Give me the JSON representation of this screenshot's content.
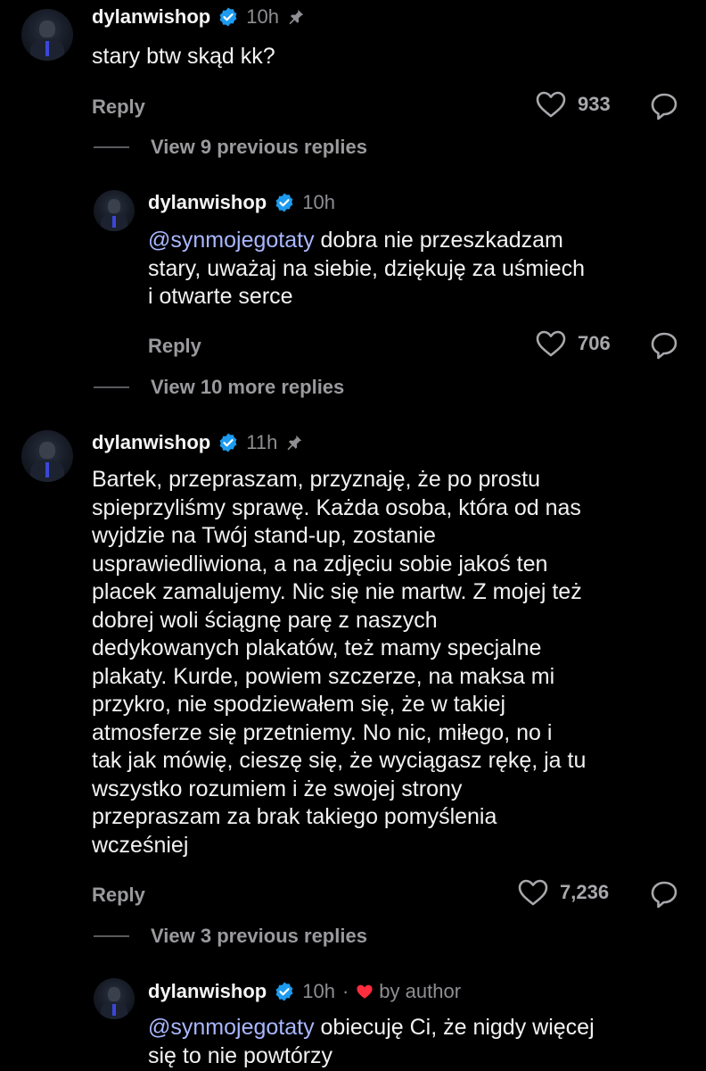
{
  "comments": [
    {
      "username": "dylanwishop",
      "time": "10h",
      "pinned": true,
      "text": "stary btw skąd kk?",
      "reply_label": "Reply",
      "likes": "933"
    },
    {
      "username": "dylanwishop",
      "time": "10h",
      "mention": "@synmojegotaty",
      "text_line1": " dobra nie przeszkadzam",
      "text_line2": "stary, uważaj na siebie, dziękuję za uśmiech",
      "text_line3": "i otwarte serce",
      "reply_label": "Reply",
      "likes": "706"
    },
    {
      "username": "dylanwishop",
      "time": "11h",
      "pinned": true,
      "lines": [
        "Bartek, przepraszam, przyznaję, że po prostu",
        "spieprzyliśmy sprawę. Każda osoba, która od nas",
        "wyjdzie na Twój stand-up, zostanie",
        "usprawiedliwiona, a na zdjęciu sobie jakoś ten",
        "placek zamalujemy. Nic się nie martw. Z mojej też",
        "dobrej woli ściągnę parę z naszych",
        "dedykowanych plakatów, też mamy specjalne",
        "plakaty. Kurde, powiem szczerze, na maksa mi",
        "przykro, nie spodziewałem się, że w takiej",
        "atmosferze się przetniemy. No nic, miłego, no i",
        "tak jak mówię, cieszę się, że wyciągasz rękę, ja tu",
        "wszystko rozumiem i że swojej strony",
        "przepraszam za brak takiego pomyślenia",
        "wcześniej"
      ],
      "reply_label": "Reply",
      "likes": "7,236"
    },
    {
      "username": "dylanwishop",
      "time": "10h",
      "separator": "·",
      "by_author": "by author",
      "mention": "@synmojegotaty",
      "text_line1": " obiecuję Ci, że nigdy więcej",
      "text_line2": "się to nie powtórzy"
    }
  ],
  "view_links": {
    "first": "View 9 previous replies",
    "second": "View 10 more replies",
    "third": "View 3 previous replies"
  },
  "colors": {
    "background": "#000000",
    "mention": "#a9b7ff",
    "verified": "#1d9bf0",
    "author_heart": "#ff2d3d"
  },
  "icons": [
    "verified-badge-icon",
    "pin-icon",
    "heart-icon",
    "reply-bubble-icon"
  ]
}
